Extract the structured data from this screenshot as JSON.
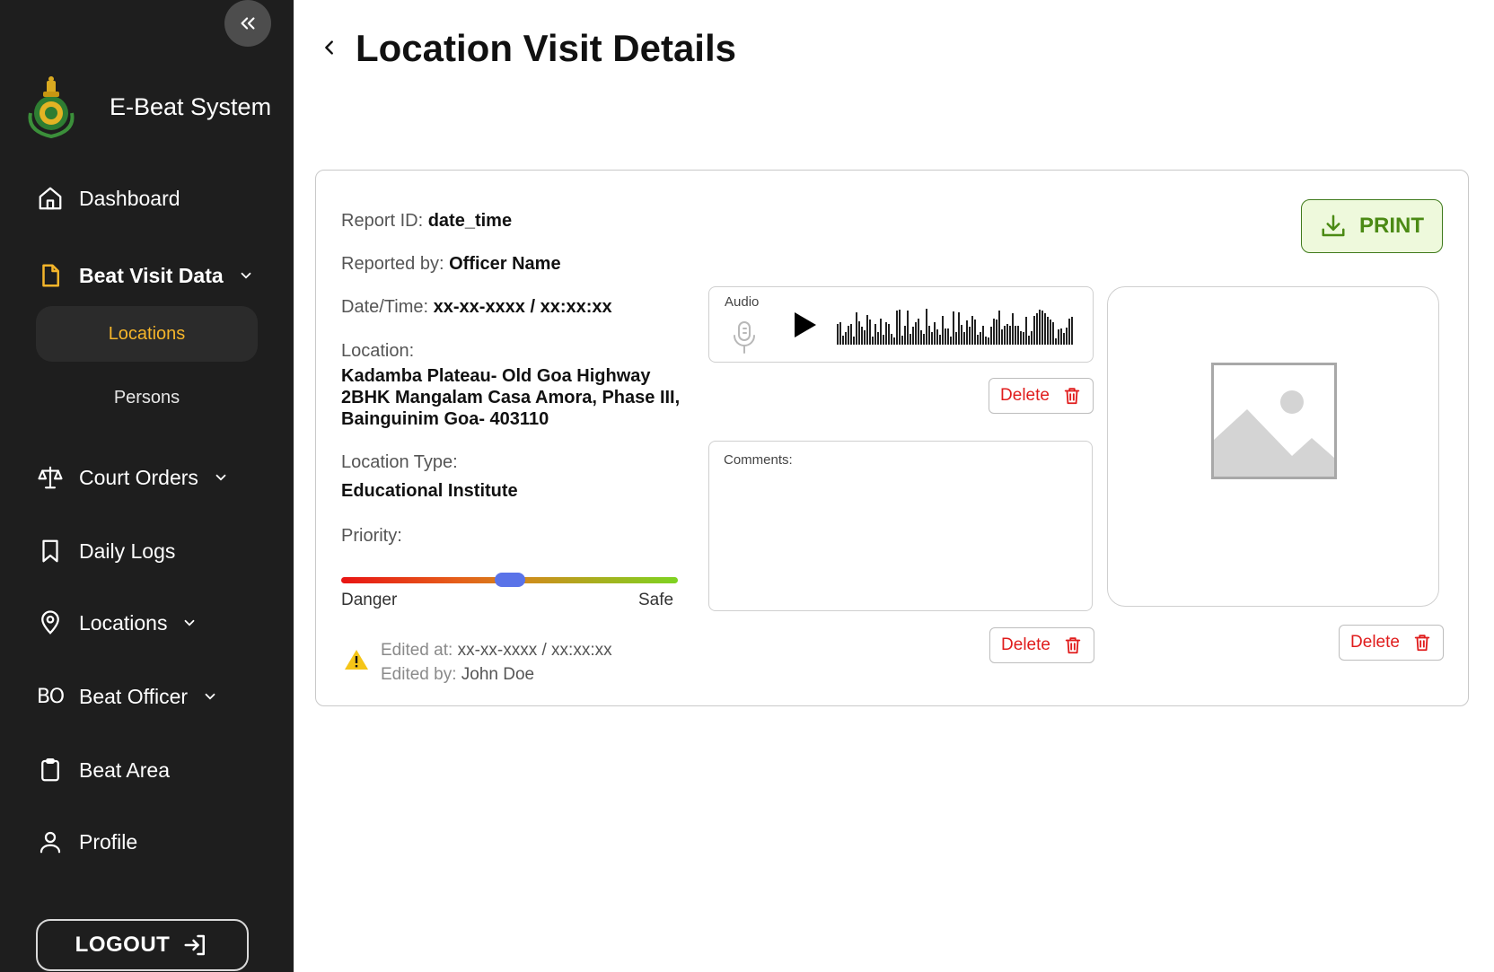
{
  "sidebar": {
    "brand": "E-Beat System",
    "items": [
      {
        "label": "Dashboard"
      },
      {
        "label": "Beat Visit Data"
      },
      {
        "label": "Court Orders"
      },
      {
        "label": "Daily Logs"
      },
      {
        "label": "Locations"
      },
      {
        "label": "Beat Officer",
        "icon_text": "BO"
      },
      {
        "label": "Beat Area"
      },
      {
        "label": "Profile"
      }
    ],
    "sub_items": [
      {
        "label": "Locations",
        "active": true
      },
      {
        "label": "Persons"
      }
    ],
    "logout": "LOGOUT",
    "accent": "#f5b52a"
  },
  "page": {
    "title": "Location Visit Details"
  },
  "report": {
    "id_label": "Report ID:",
    "id_value": "date_time",
    "reported_by_label": "Reported by:",
    "reported_by_value": "Officer Name",
    "datetime_label": "Date/Time:",
    "datetime_value": "xx-xx-xxxx / xx:xx:xx",
    "location_label": "Location:",
    "location_lines": [
      "Kadamba Plateau- Old Goa Highway",
      "2BHK Mangalam Casa Amora, Phase III,",
      "Bainguinim Goa- 403110"
    ],
    "location_type_label": "Location Type:",
    "location_type_value": "Educational Institute",
    "priority_label": "Priority:",
    "priority_min": "Danger",
    "priority_max": "Safe",
    "priority_level": 0.5,
    "edited_at_label": "Edited at:",
    "edited_at_value": "xx-xx-xxxx / xx:xx:xx",
    "edited_by_label": "Edited by:",
    "edited_by_value": "John Doe"
  },
  "actions": {
    "print": "PRINT",
    "delete": "Delete"
  },
  "audio": {
    "label": "Audio"
  },
  "comments": {
    "label": "Comments:"
  }
}
